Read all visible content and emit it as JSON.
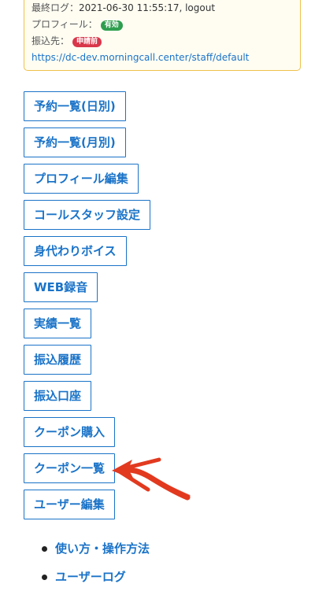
{
  "info": {
    "last_login_label": "最終ログ：",
    "last_login_value": "2021-06-30 11:55:17, logout",
    "profile_label": "プロフィール：",
    "profile_badge": "有効",
    "transfer_label": "振込先：",
    "transfer_badge": "申請前",
    "url": "https://dc-dev.morningcall.center/staff/default"
  },
  "menu": [
    "予約一覧(日別)",
    "予約一覧(月別)",
    "プロフィール編集",
    "コールスタッフ設定",
    "身代わりボイス",
    "WEB録音",
    "実績一覧",
    "振込履歴",
    "振込口座",
    "クーポン購入",
    "クーポン一覧",
    "ユーザー編集"
  ],
  "links": [
    "使い方・操作方法",
    "ユーザーログ"
  ],
  "colors": {
    "accent": "#1a73c8",
    "badge_active": "#2e9e4f",
    "badge_pending": "#d9364a",
    "annotation_arrow": "#e23a1f"
  }
}
